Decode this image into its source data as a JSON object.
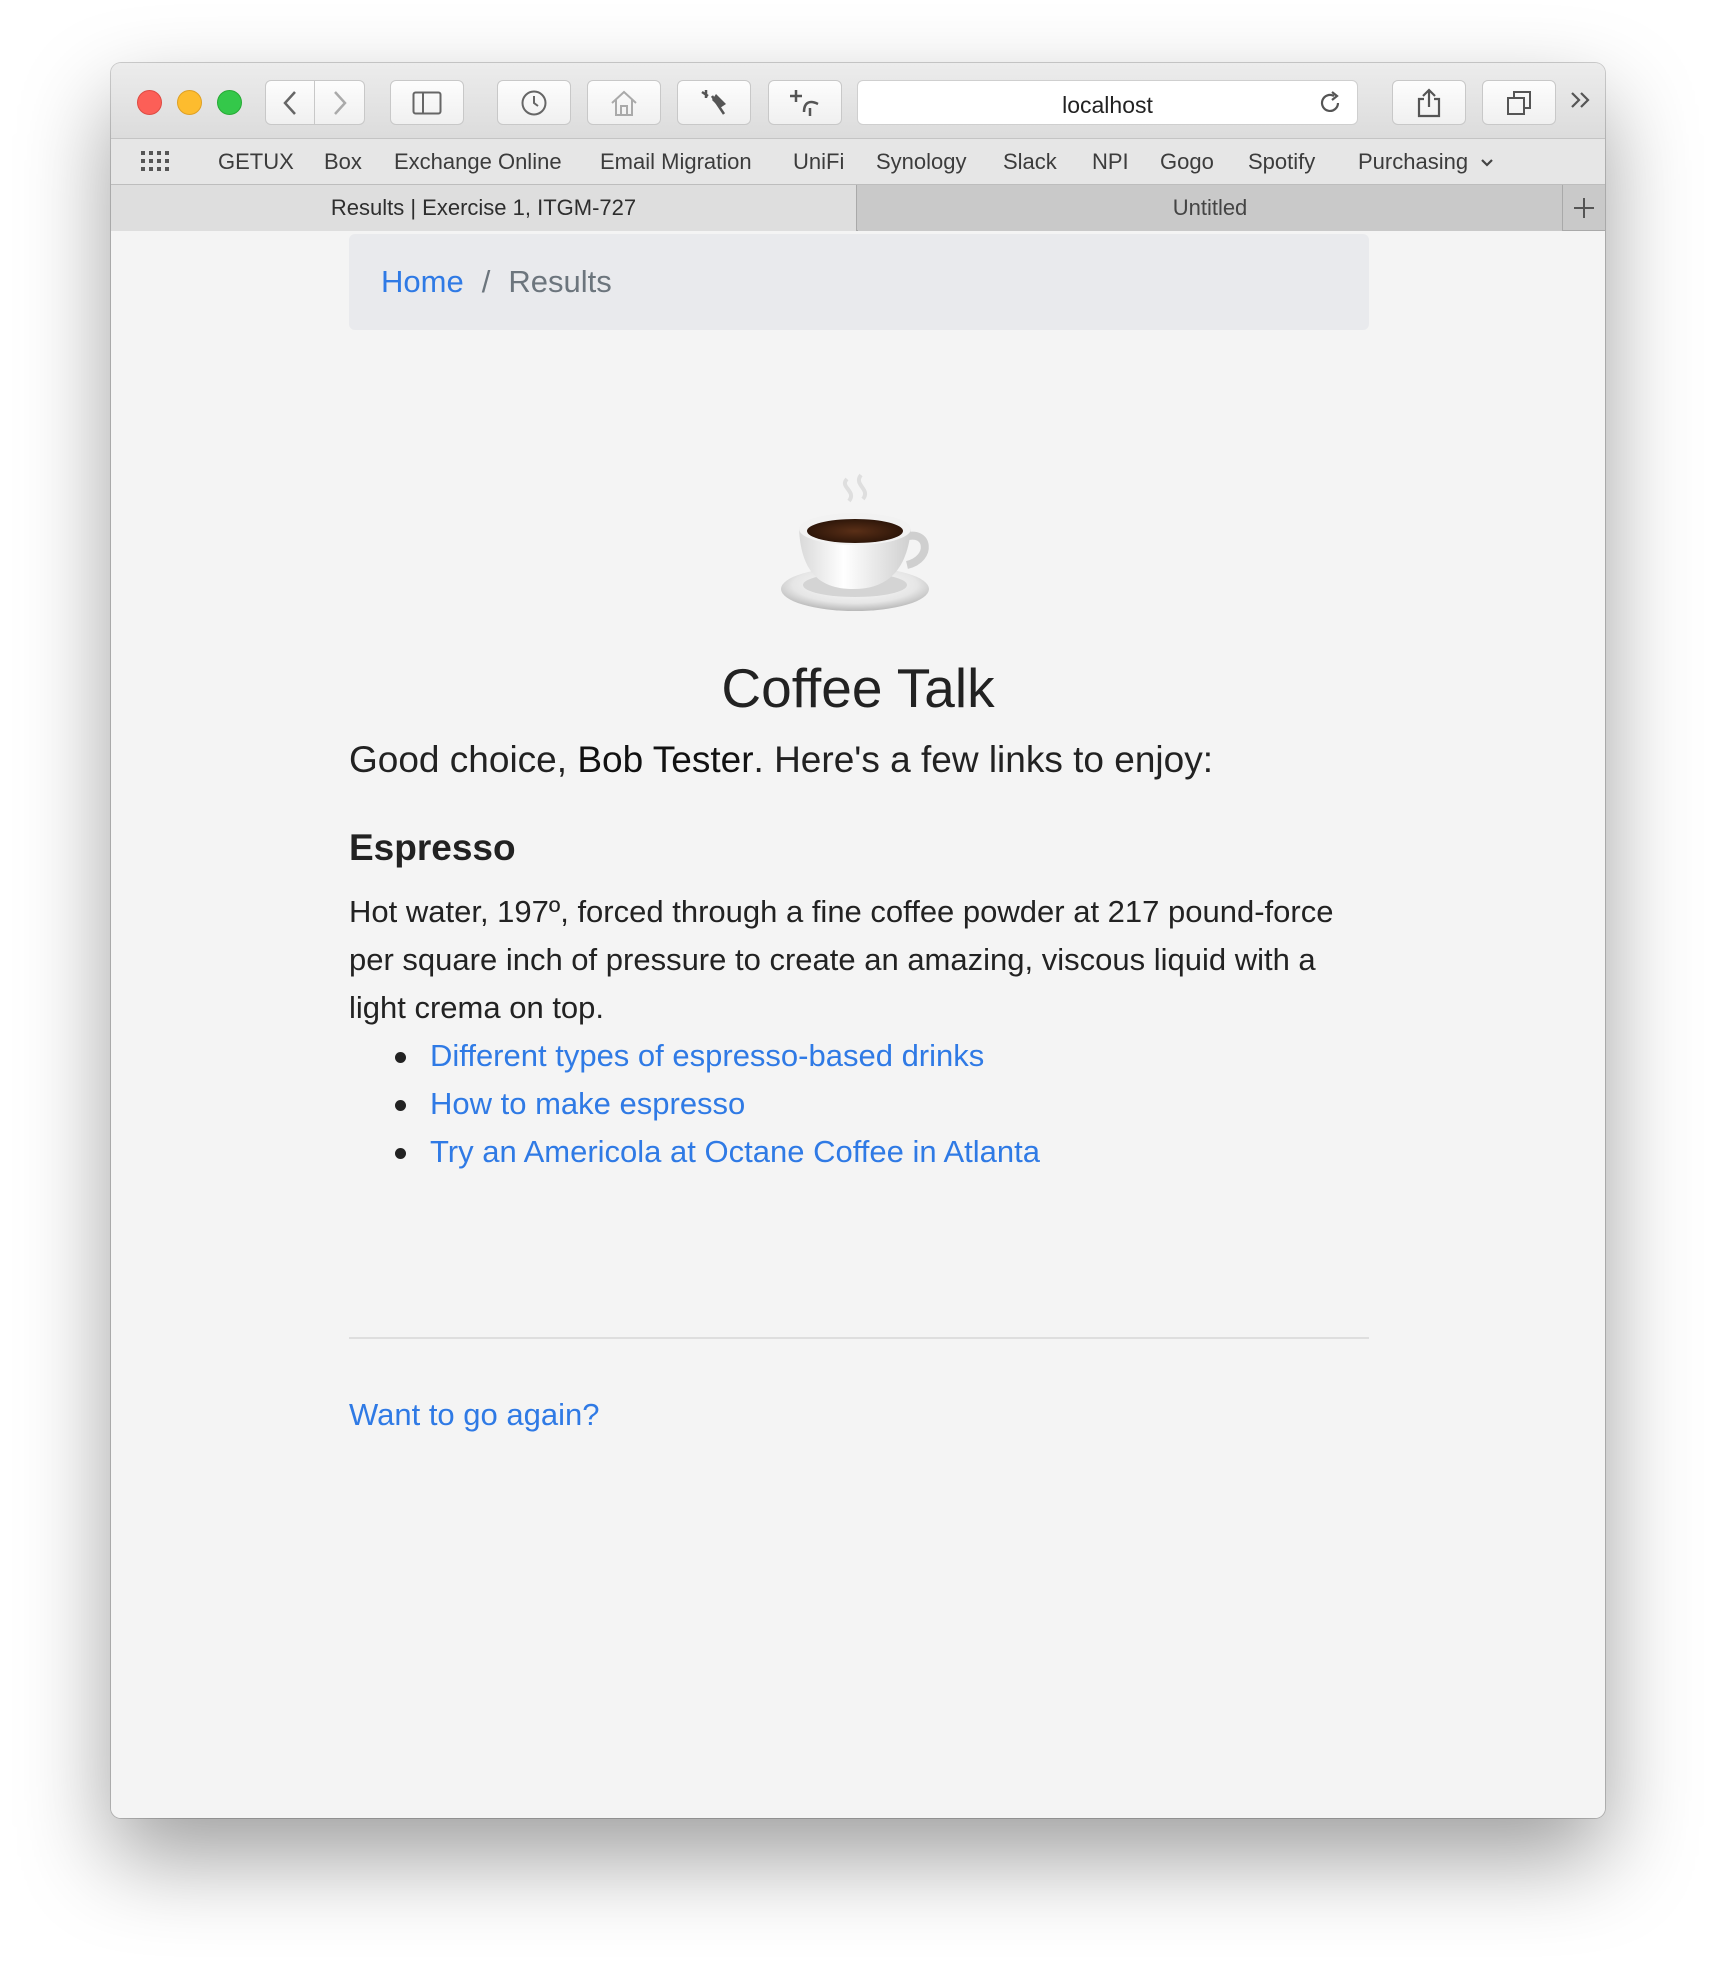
{
  "browser": {
    "url": "localhost",
    "bookmarks": [
      "GETUX",
      "Box",
      "Exchange Online",
      "Email Migration",
      "UniFi",
      "Synology",
      "Slack",
      "NPI",
      "Gogo",
      "Spotify",
      "Purchasing"
    ],
    "tabs": {
      "active": "Results | Exercise 1, ITGM-727",
      "inactive": "Untitled"
    }
  },
  "breadcrumb": {
    "home": "Home",
    "separator": "/",
    "current": "Results"
  },
  "page": {
    "icon": "coffee-cup-emoji",
    "title": "Coffee Talk",
    "greeting_prefix": "Good choice, ",
    "user_name": "Bob Tester",
    "greeting_suffix": ". Here's a few links to enjoy:",
    "section_title": "Espresso",
    "description": "Hot water, 197º, forced through a fine coffee powder at 217 pound-force per square inch of pressure to create an amazing, viscous liquid with a light crema on top.",
    "links": [
      "Different types of espresso-based drinks",
      "How to make espresso",
      "Try an Americola at Octane Coffee in Atlanta"
    ],
    "again_link": "Want to go again?"
  },
  "colors": {
    "link": "#2f7ae5",
    "text": "#222222",
    "breadcrumb_bg": "#e9eaed",
    "page_bg": "#f4f4f4"
  }
}
